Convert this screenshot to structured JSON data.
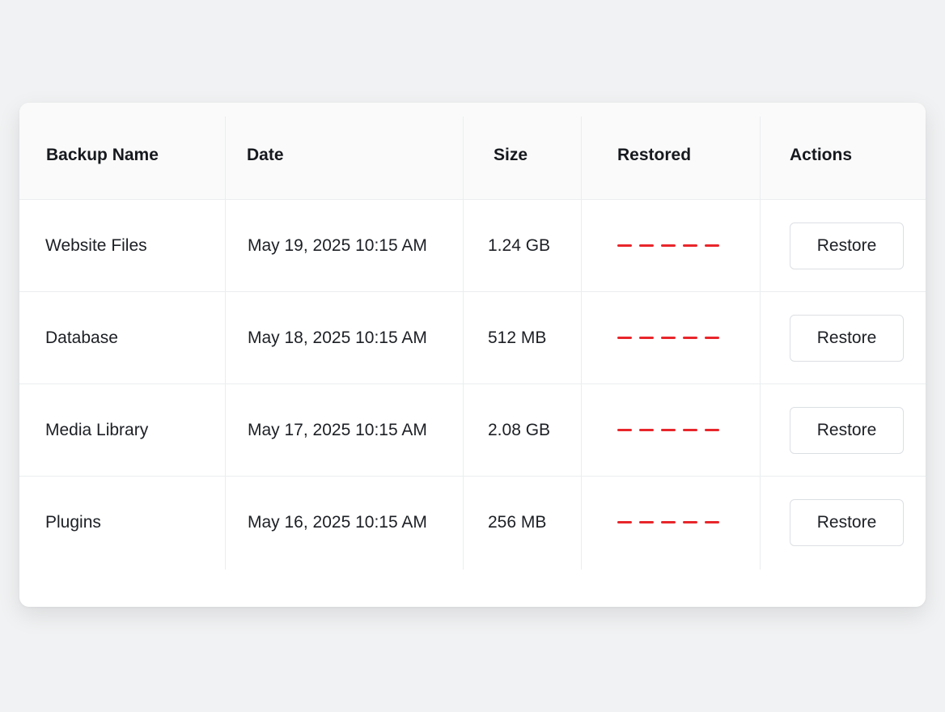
{
  "table": {
    "headers": {
      "name": "Backup Name",
      "date": "Date",
      "size": "Size",
      "restored": "Restored",
      "actions": "Actions"
    },
    "rows": [
      {
        "name": "Website Files",
        "date": "May 19, 2025 10:15 AM",
        "size": "1.24 GB",
        "restore_label": "Restore"
      },
      {
        "name": "Database",
        "date": "May 18, 2025 10:15 AM",
        "size": "512 MB",
        "restore_label": "Restore"
      },
      {
        "name": "Media Library",
        "date": "May 17, 2025 10:15 AM",
        "size": "2.08 GB",
        "restore_label": "Restore"
      },
      {
        "name": "Plugins",
        "date": "May 16, 2025 10:15 AM",
        "size": "256 MB",
        "restore_label": "Restore"
      }
    ]
  },
  "colors": {
    "restored_indicator": "#e8262b",
    "background": "#f1f2f3",
    "card": "#ffffff"
  }
}
